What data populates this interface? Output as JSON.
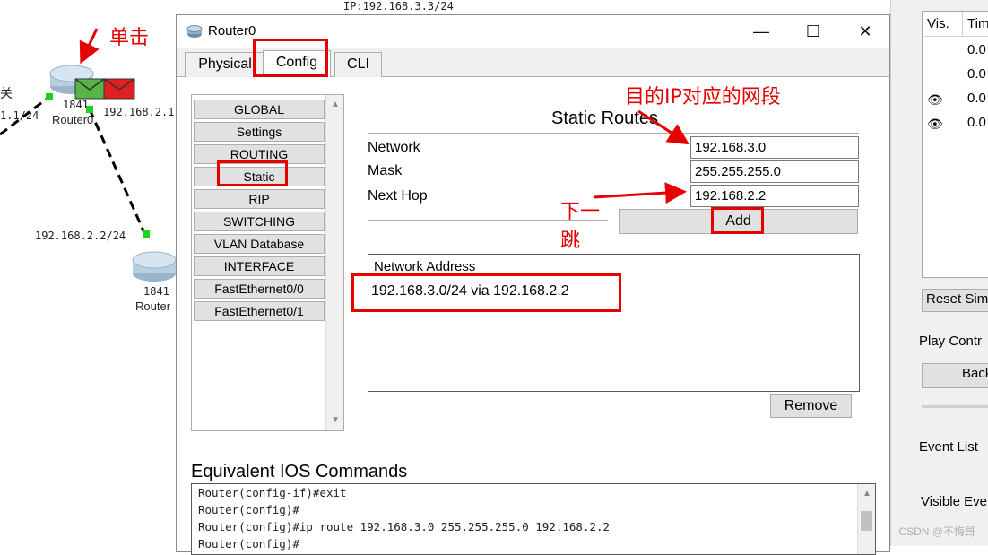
{
  "topology": {
    "ip_top": "IP:192.168.3.3/24",
    "left_text": "关",
    "left_ip": "1.1/24",
    "router0_model": "1841",
    "router0_name": "Router0",
    "router0_ip": "192.168.2.1",
    "link_ip": "192.168.2.2/24",
    "router1_model": "1841",
    "router1_name": "Router"
  },
  "dialog": {
    "title": "Router0",
    "tabs": [
      "Physical",
      "Config",
      "CLI"
    ],
    "active_tab": "Config",
    "nav_items": [
      "GLOBAL",
      "Settings",
      "ROUTING",
      "Static",
      "RIP",
      "SWITCHING",
      "VLAN Database",
      "INTERFACE",
      "FastEthernet0/0",
      "FastEthernet0/1"
    ],
    "selected_nav": "Static",
    "static_routes": {
      "title": "Static Routes",
      "network_label": "Network",
      "network_value": "192.168.3.0",
      "mask_label": "Mask",
      "mask_value": "255.255.255.0",
      "next_hop_label": "Next Hop",
      "next_hop_value": "192.168.2.2",
      "add_label": "Add",
      "table_header": "Network Address",
      "routes": [
        "192.168.3.0/24 via 192.168.2.2"
      ],
      "remove_label": "Remove"
    },
    "ios": {
      "title": "Equivalent IOS Commands",
      "lines": [
        "Router(config-if)#exit",
        "Router(config)#",
        "Router(config)#ip route 192.168.3.0 255.255.255.0 192.168.2.2",
        "Router(config)#"
      ]
    }
  },
  "sim_panel": {
    "col_vis": "Vis.",
    "col_time": "Tim",
    "times": [
      "0.0",
      "0.0",
      "0.0",
      "0.0"
    ],
    "reset_label": "Reset Sim",
    "play_controls_label": "Play Contr",
    "back_label": "Back",
    "event_list_label": "Event List",
    "visible_events_label": "Visible Eve"
  },
  "annotations": {
    "click_note": "单击",
    "dest_note": "目的IP对应的网段",
    "next_hop_note_1": "下一",
    "next_hop_note_2": "跳"
  },
  "watermark": "CSDN @不悔哥",
  "colors": {
    "annotation_red": "#e60000",
    "dialog_bg": "#f0f0f0"
  }
}
